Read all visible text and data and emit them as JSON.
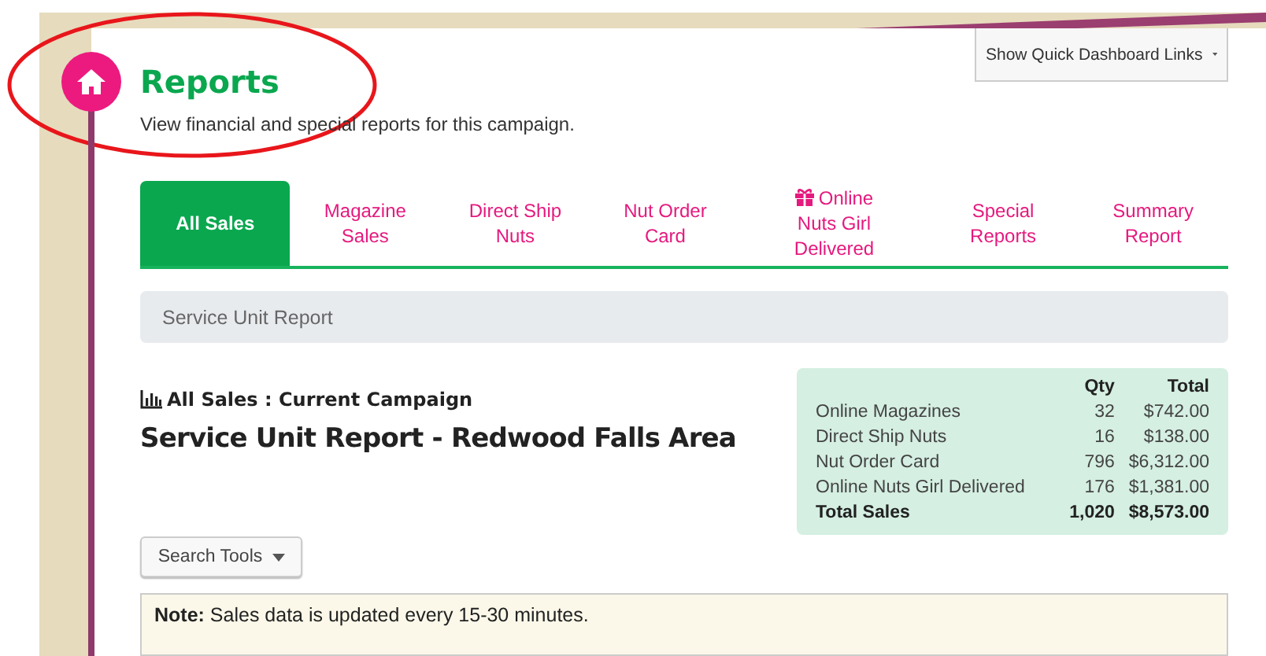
{
  "header": {
    "title": "Reports",
    "subtitle": "View financial and special reports for this campaign."
  },
  "quick_links_button": {
    "label": "Show Quick Dashboard Links"
  },
  "tabs": [
    {
      "label": "All Sales",
      "selected": true,
      "kind": "text"
    },
    {
      "label": "Magazine Sales",
      "selected": false,
      "kind": "text"
    },
    {
      "label": "Direct Ship Nuts",
      "selected": false,
      "kind": "text"
    },
    {
      "label": "Nut Order Card",
      "selected": false,
      "kind": "text"
    },
    {
      "label": "Online Nuts Girl Delivered",
      "selected": false,
      "kind": "gift"
    },
    {
      "label": "Special Reports",
      "selected": false,
      "kind": "text"
    },
    {
      "label": "Summary Report",
      "selected": false,
      "kind": "text"
    }
  ],
  "section_bar": {
    "label": "Service Unit Report"
  },
  "report": {
    "subtitle": "All Sales : Current Campaign",
    "title": "Service Unit Report - Redwood Falls Area"
  },
  "summary": {
    "columns": [
      "Qty",
      "Total"
    ],
    "rows": [
      {
        "label": "Online Magazines",
        "qty": "32",
        "total": "$742.00",
        "kind": "item"
      },
      {
        "label": "Direct Ship Nuts",
        "qty": "16",
        "total": "$138.00",
        "kind": "item"
      },
      {
        "label": "Nut Order Card",
        "qty": "796",
        "total": "$6,312.00",
        "kind": "item"
      },
      {
        "label": "Online Nuts Girl Delivered",
        "qty": "176",
        "total": "$1,381.00",
        "kind": "item"
      },
      {
        "label": "Total Sales",
        "qty": "1,020",
        "total": "$8,573.00",
        "kind": "total"
      }
    ]
  },
  "search_tools": {
    "label": "Search Tools"
  },
  "note": {
    "text": "**Note:** Sales data is updated every 15-30 minutes."
  }
}
